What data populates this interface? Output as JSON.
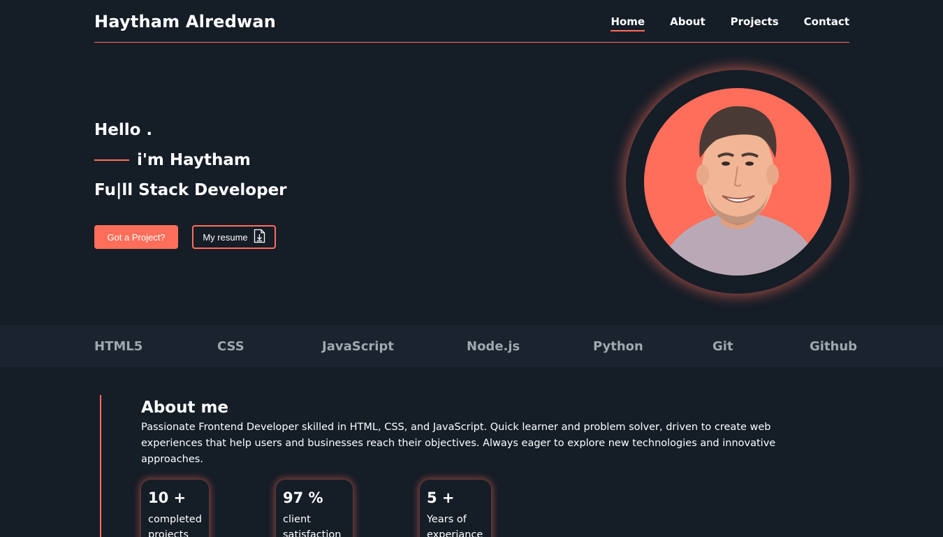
{
  "header": {
    "brand": "Haytham Alredwan",
    "nav": [
      {
        "label": "Home",
        "active": true
      },
      {
        "label": "About",
        "active": false
      },
      {
        "label": "Projects",
        "active": false
      },
      {
        "label": "Contact",
        "active": false
      }
    ]
  },
  "hero": {
    "hello": "Hello .",
    "name": "i'm Haytham",
    "role": "Fu|ll Stack Developer",
    "primary_button": "Got a Project?",
    "secondary_button": "My resume",
    "secondary_icon": "file-download-icon"
  },
  "skills": [
    "HTML5",
    "CSS",
    "JavaScript",
    "Node.js",
    "Python",
    "Git",
    "Github"
  ],
  "about": {
    "title": "About me",
    "text": "Passionate Frontend Developer skilled in HTML, CSS, and JavaScript. Quick learner and problem solver, driven to create web experiences that help users and businesses reach their objectives. Always eager to explore new technologies and innovative approaches.",
    "stats": [
      {
        "value": "10 +",
        "label": "completed projects"
      },
      {
        "value": "97 %",
        "label": "client satisfaction"
      },
      {
        "value": "5 +",
        "label": "Years of experiance"
      }
    ]
  },
  "colors": {
    "background": "#151d27",
    "accent": "#ff6e5a",
    "skills_bar": "#1a232e",
    "skills_text": "#a0a7af"
  }
}
